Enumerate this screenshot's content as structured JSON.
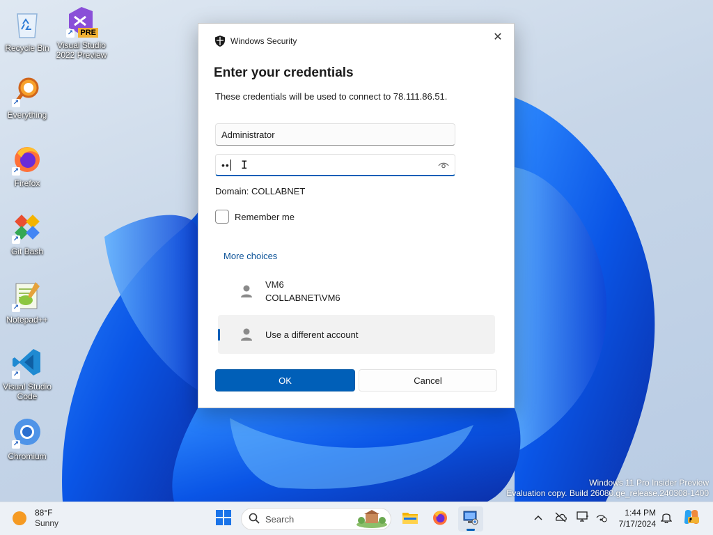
{
  "desktop": {
    "icons": [
      {
        "label": "Recycle Bin"
      },
      {
        "label": "Visual Studio 2022 Preview",
        "badge": "PRE"
      },
      {
        "label": "Everything"
      },
      {
        "label": "Firefox"
      },
      {
        "label": "Git Bash"
      },
      {
        "label": "Notepad++"
      },
      {
        "label": "Visual Studio Code"
      },
      {
        "label": "Chromium"
      }
    ],
    "watermark": {
      "line1": "Windows 11 Pro Insider Preview",
      "line2": "Evaluation copy. Build 26080.ge_release.240308-1400"
    }
  },
  "dialog": {
    "app_name": "Windows Security",
    "close_glyph": "✕",
    "title": "Enter your credentials",
    "description": "These credentials will be used to connect to 78.111.86.51.",
    "username_value": "Administrator",
    "password_dots": "••",
    "domain_text": "Domain: COLLABNET",
    "remember_label": "Remember me",
    "more_choices_label": "More choices",
    "accounts": [
      {
        "line1": "VM6",
        "line2": "COLLABNET\\VM6"
      },
      {
        "line1": "Use a different account"
      }
    ],
    "ok_label": "OK",
    "cancel_label": "Cancel",
    "accent": "#005fb8"
  },
  "taskbar": {
    "weather": {
      "temp": "88°F",
      "condition": "Sunny"
    },
    "search_label": "Search",
    "pinned": [
      "start-icon",
      "search",
      "file-explorer-icon",
      "firefox-icon",
      "remote-desktop-icon"
    ],
    "tray": [
      "chevron-up-icon",
      "onedrive-offline-icon",
      "display-icon",
      "network-icon"
    ],
    "clock": {
      "time": "1:44 PM",
      "date": "7/17/2024"
    }
  }
}
